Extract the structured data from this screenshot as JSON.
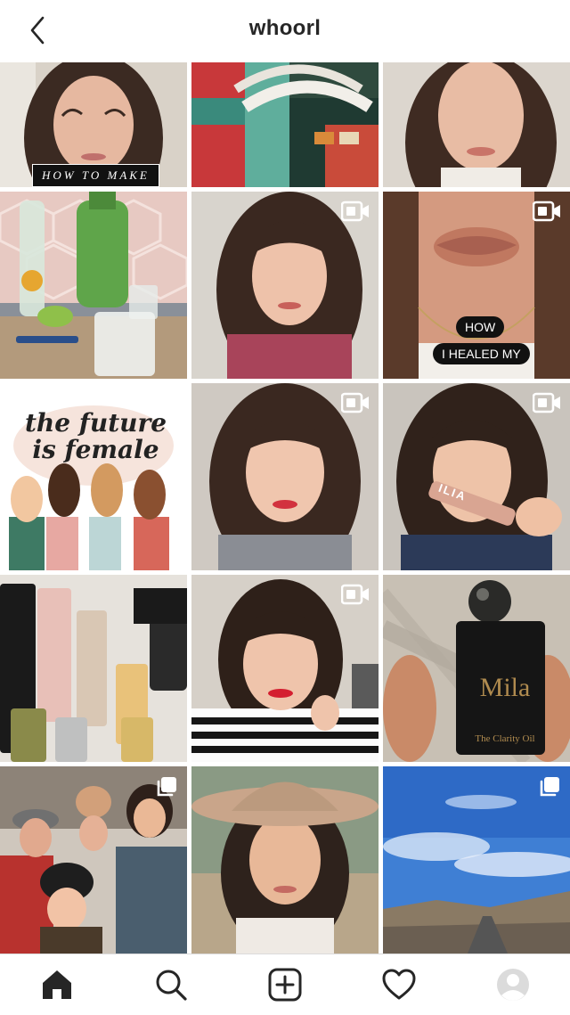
{
  "header": {
    "title": "whoorl",
    "back_icon": "chevron-left-icon"
  },
  "posts": {
    "p1_caption": "HOW TO MAKE",
    "p6_line1": "HOW",
    "p6_line2": "I HEALED MY",
    "p7_text": "the future is female",
    "p9_brand": "ILIA",
    "p12_brand": "Mila",
    "p12_product": "The Clarity Oil"
  },
  "badges": {
    "video": "video-icon",
    "carousel": "carousel-icon"
  },
  "bottom_nav": {
    "items": [
      "home-icon",
      "search-icon",
      "add-icon",
      "heart-icon",
      "profile-avatar"
    ]
  },
  "colors": {
    "text": "#262626",
    "border": "#dbdbdb",
    "badge": "#ffffff"
  }
}
